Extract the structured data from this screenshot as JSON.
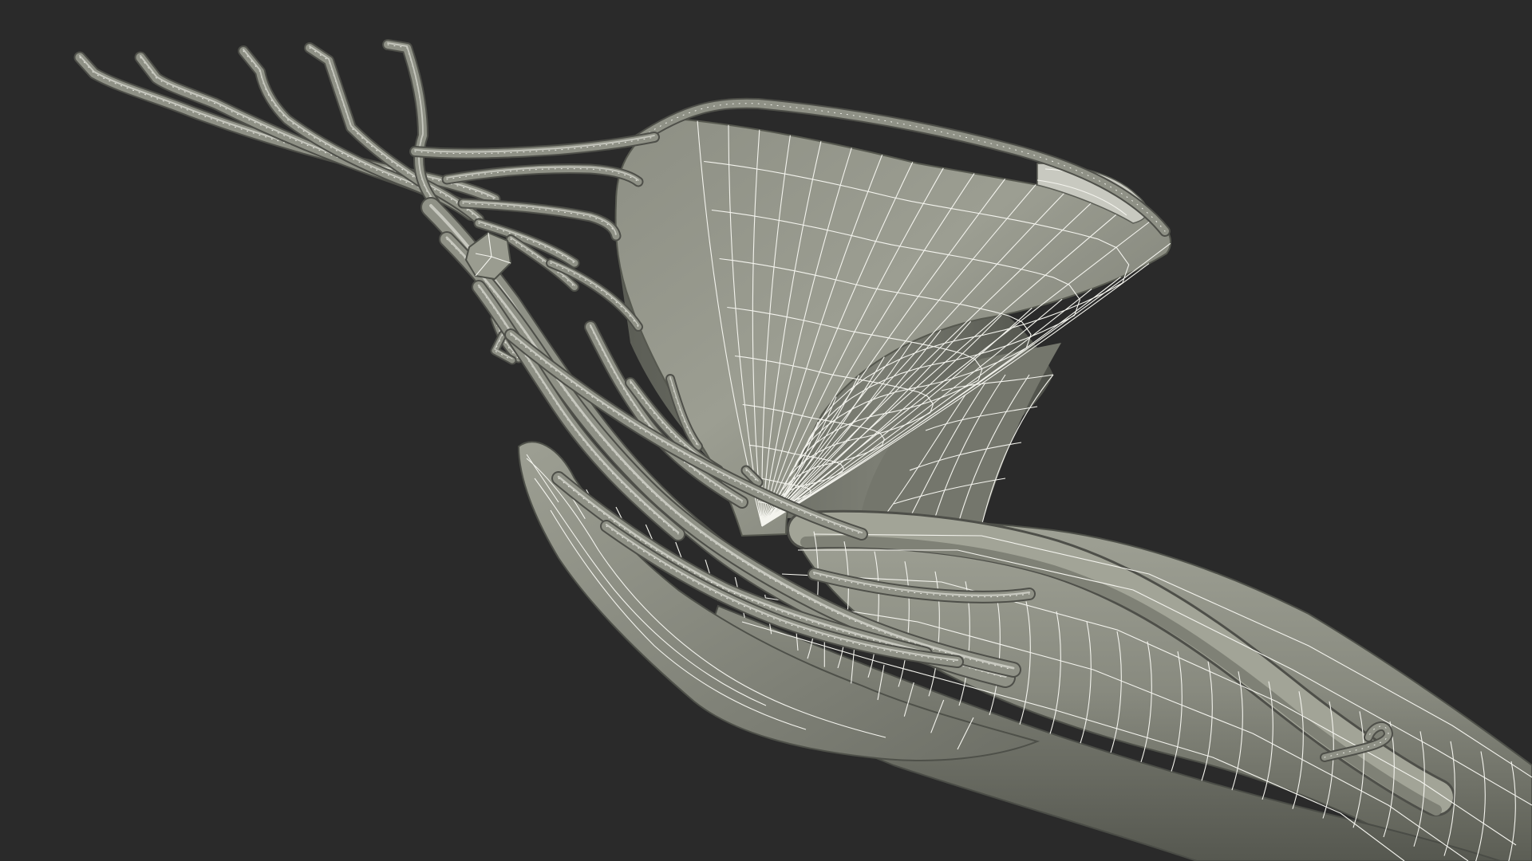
{
  "scene": {
    "subject": "wireframe-3d-render",
    "colors": {
      "background": "#2a2a2a",
      "surface_light": "#a4a69a",
      "surface_mid": "#85877c",
      "surface_dark": "#56584f",
      "wire": "#f4f4ee"
    }
  }
}
